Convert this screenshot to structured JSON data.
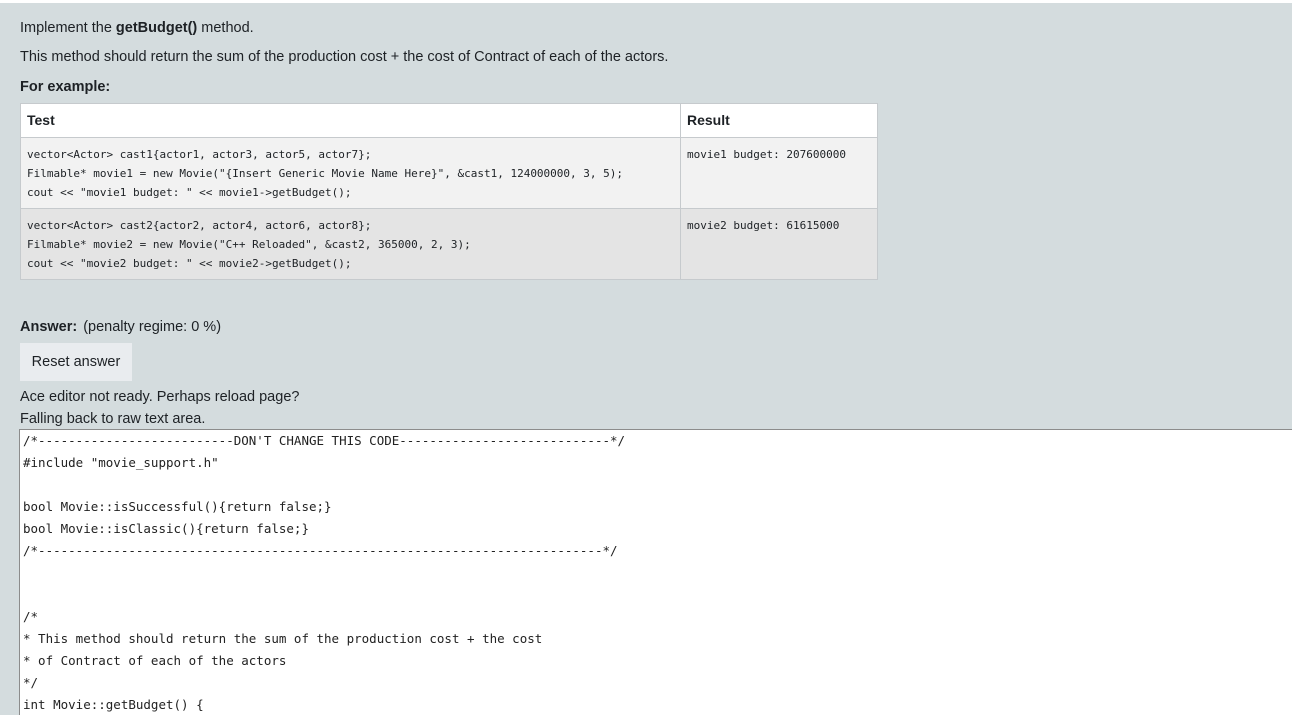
{
  "question": {
    "intro_prefix": "Implement the ",
    "intro_method": "getBudget()",
    "intro_suffix": " method.",
    "description": "This method should return the sum of the production cost + the cost of Contract of each of the actors.",
    "example_heading": "For example:"
  },
  "example_table": {
    "headers": [
      "Test",
      "Result"
    ],
    "rows": [
      {
        "test": "vector<Actor> cast1{actor1, actor3, actor5, actor7};\nFilmable* movie1 = new Movie(\"{Insert Generic Movie Name Here}\", &cast1, 124000000, 3, 5);\ncout << \"movie1 budget: \" << movie1->getBudget();",
        "result": "movie1 budget: 207600000"
      },
      {
        "test": "vector<Actor> cast2{actor2, actor4, actor6, actor8};\nFilmable* movie2 = new Movie(\"C++ Reloaded\", &cast2, 365000, 2, 3);\ncout << \"movie2 budget: \" << movie2->getBudget();",
        "result": "movie2 budget: 61615000"
      }
    ]
  },
  "answer": {
    "label": "Answer:",
    "penalty": "(penalty regime: 0 %)",
    "reset_button": "Reset answer",
    "notice_line1": "Ace editor not ready. Perhaps reload page?",
    "notice_line2": "Falling back to raw text area."
  },
  "code_lines": [
    "/*--------------------------DON'T CHANGE THIS CODE----------------------------*/",
    "#include \"movie_support.h\"",
    "",
    "bool Movie::isSuccessful(){return false;}",
    "bool Movie::isClassic(){return false;}",
    "/*---------------------------------------------------------------------------*/",
    "",
    "",
    "/*",
    "* This method should return the sum of the production cost + the cost",
    "* of Contract of each of the actors",
    "*/",
    "int Movie::getBudget() {"
  ]
}
